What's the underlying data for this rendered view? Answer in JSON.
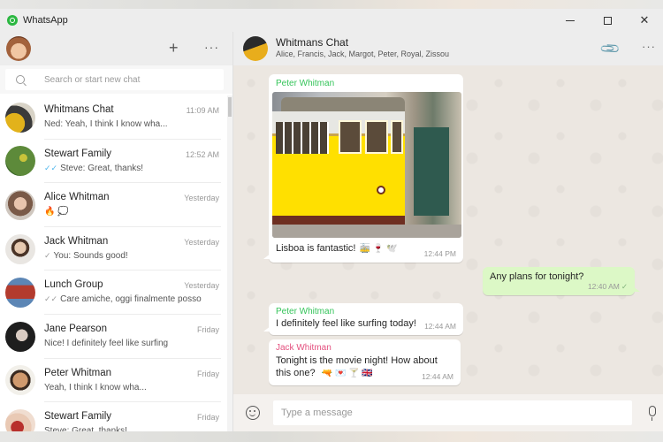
{
  "window": {
    "app_title": "WhatsApp",
    "controls": {
      "minimize": "minimize",
      "maximize": "maximize",
      "close": "✕"
    }
  },
  "left_panel": {
    "header": {
      "new_chat_icon": "+",
      "menu_icon": "···"
    },
    "search": {
      "placeholder": "Search or start new chat",
      "value": ""
    },
    "chats": [
      {
        "name": "Whitmans Chat",
        "time": "11:09 AM",
        "tick": "",
        "preview": "Ned: Yeah, I think I know wha...",
        "avatar_color": "#d8b02a"
      },
      {
        "name": "Stewart Family",
        "time": "12:52 AM",
        "tick": "✓✓",
        "tick_color": "#4fb6ec",
        "preview": "Steve: Great, thanks!",
        "avatar_color": "#5d8a3a"
      },
      {
        "name": "Alice Whitman",
        "time": "Yesterday",
        "tick": "",
        "preview": "🔥 💭",
        "avatar_color": "#b9a79a"
      },
      {
        "name": "Jack Whitman",
        "time": "Yesterday",
        "tick": "✓",
        "tick_color": "#9a9a9a",
        "preview": "You: Sounds good!",
        "avatar_color": "#cfc6bd"
      },
      {
        "name": "Lunch Group",
        "time": "Yesterday",
        "tick": "✓✓",
        "tick_color": "#9a9a9a",
        "preview": "Care amiche, oggi finalmente posso",
        "avatar_color": "#b33b2e"
      },
      {
        "name": "Jane Pearson",
        "time": "Friday",
        "tick": "",
        "preview": "Nice! I definitely feel like surfing",
        "avatar_color": "#2a2a2a"
      },
      {
        "name": "Peter Whitman",
        "time": "Friday",
        "tick": "",
        "preview": "Yeah, I think I know wha...",
        "avatar_color": "#c98a5e"
      },
      {
        "name": "Stewart Family",
        "time": "Friday",
        "tick": "",
        "preview": "Steve: Great, thanks!",
        "avatar_color": "#c9827a"
      }
    ]
  },
  "conversation": {
    "header": {
      "title": "Whitmans Chat",
      "members": "Alice, Francis, Jack, Margot, Peter, Royal, Zissou",
      "attach_icon": "📎",
      "menu_icon": "···"
    },
    "messages": [
      {
        "direction": "in",
        "sender": "Peter Whitman",
        "sender_color": "#35c45a",
        "has_image": true,
        "image_alt": "Yellow tram in Lisbon",
        "text": "Lisboa is fantastic!",
        "emoji": "🚋 🍷 🕊️",
        "time": "12:44 PM"
      },
      {
        "direction": "out",
        "text": "Any plans for tonight?",
        "time": "12:40 AM",
        "tick": "✓"
      },
      {
        "direction": "in",
        "sender": "Peter Whitman",
        "sender_color": "#35c45a",
        "text": "I definitely feel like surfing today!",
        "time": "12:44 AM"
      },
      {
        "direction": "in",
        "sender": "Jack Whitman",
        "sender_color": "#e4517f",
        "text": "Tonight is the movie night! How about this one?",
        "emoji": "🔫 💌 🍸 🇬🇧",
        "time": "12:44 AM"
      }
    ],
    "composer": {
      "placeholder": "Type a message",
      "value": ""
    }
  }
}
